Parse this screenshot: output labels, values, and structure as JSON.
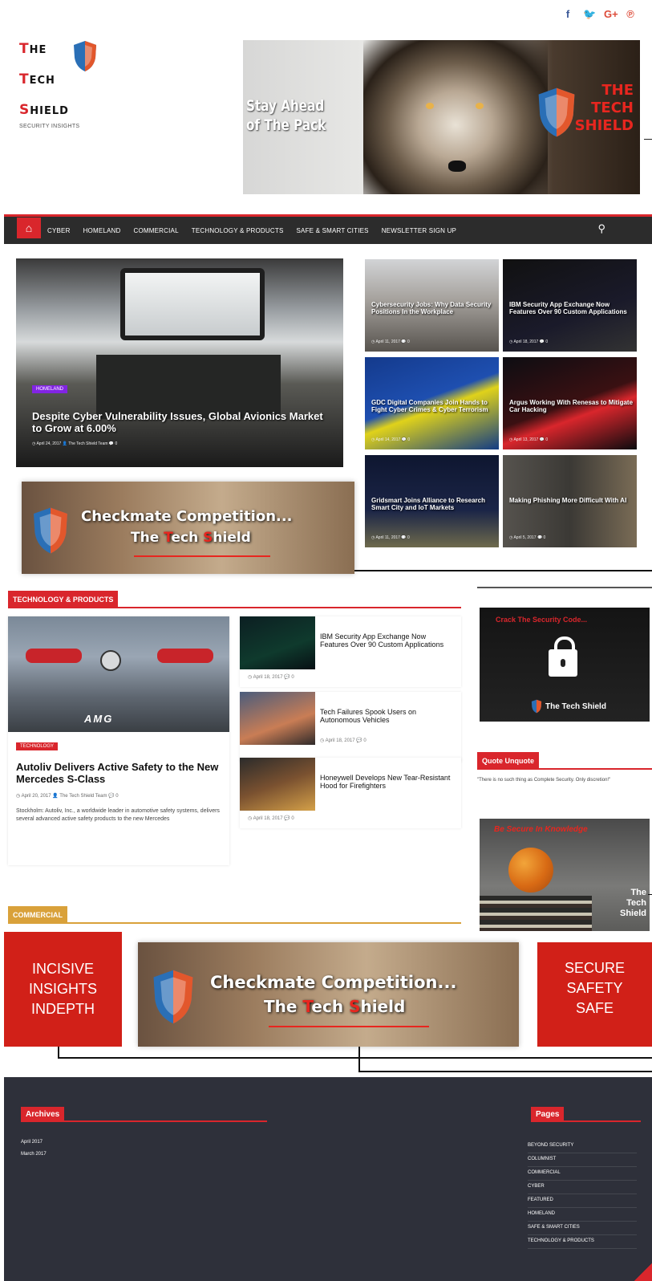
{
  "social": {
    "facebook": "f",
    "twitter": "🐦",
    "googleplus": "G+",
    "pinterest": "℗"
  },
  "logo": {
    "line1_cap": "T",
    "line1_rest": "HE",
    "line2_cap": "T",
    "line2_rest": "ECH",
    "line3_cap": "S",
    "line3_rest": "HIELD",
    "tagline": "SECURITY INSIGHTS",
    "icon": "shield-icon"
  },
  "hero": {
    "slogan_line1": "Stay Ahead",
    "slogan_line2": "of The Pack",
    "brand_line1": "THE",
    "brand_line2": "TECH",
    "brand_line3": "SHIELD"
  },
  "nav": {
    "home_icon": "⌂",
    "items": [
      "CYBER",
      "HOMELAND",
      "COMMERCIAL",
      "TECHNOLOGY & PRODUCTS",
      "SAFE & SMART CITIES",
      "NEWSLETTER SIGN UP"
    ],
    "search_icon": "⚲"
  },
  "featured": {
    "main": {
      "tag": "HOMELAND",
      "title": "Despite Cyber Vulnerability Issues, Global Avionics Market to Grow at 6.00%",
      "meta": "◷ April 24, 2017   👤 The Tech Shield Team   💬 0"
    },
    "tiles": [
      {
        "title": "Cybersecurity Jobs: Why Data Security Positions In the Workplace",
        "meta": "◷ April 11, 2017   💬 0"
      },
      {
        "title": "IBM Security App Exchange Now Features Over 90 Custom Applications",
        "meta": "◷ April 18, 2017   💬 0"
      },
      {
        "title": "GDC Digital Companies Join Hands to Fight Cyber Crimes & Cyber Terrorism",
        "meta": "◷ April 14, 2017   💬 0"
      },
      {
        "title": "Argus Working With Renesas to Mitigate Car Hacking",
        "meta": "◷ April 13, 2017   💬 0"
      },
      {
        "title": "Gridsmart Joins Alliance to Research Smart City and IoT Markets",
        "meta": "◷ April 11, 2017   💬 0"
      },
      {
        "title": "Making Phishing More Difficult With AI",
        "meta": "◷ April 5, 2017   💬 0"
      }
    ]
  },
  "checkmate": {
    "line1": "Checkmate Competition...",
    "line2_a": "The ",
    "line2_b": "T",
    "line2_c": "ech ",
    "line2_d": "S",
    "line2_e": "hield"
  },
  "sections": {
    "tech_products": "TECHNOLOGY & PRODUCTS",
    "commercial": "COMMERCIAL",
    "quote": "Quote Unquote"
  },
  "tech_big": {
    "image_text": "AMG",
    "tag": "TECHNOLOGY",
    "title": "Autoliv Delivers Active Safety to the New Mercedes S-Class",
    "meta": "◷ April 20, 2017   👤 The Tech Shield Team   💬 0",
    "excerpt": "Stockholm: Autoliv, Inc., a worldwide leader in automotive safety systems, delivers several advanced active safety products to the new Mercedes"
  },
  "tech_side": [
    {
      "title": "IBM Security App Exchange Now Features Over 90 Custom Applications",
      "meta": "◷ April 18, 2017   💬 0"
    },
    {
      "title": "Tech Failures Spook Users on Autonomous Vehicles",
      "meta": "◷ April 18, 2017   💬 0"
    },
    {
      "title": "Honeywell Develops New Tear-Resistant Hood for Firefighters",
      "meta": "◷ April 18, 2017   💬 0"
    }
  ],
  "widgets": {
    "code_title": "Crack The Security Code...",
    "code_brand": "The Tech Shield",
    "quote_text": "\"There is no such thing as Complete Security. Only discretion!\"",
    "know_title": "Be Secure In Knowledge",
    "know_brand_line1": "The",
    "know_brand_line2": "Tech",
    "know_brand_line3": "Shield"
  },
  "redboxes": {
    "left_line1": "INCISIVE",
    "left_line2": "INSIGHTS",
    "left_line3": "INDEPTH",
    "right_line1": "SECURE",
    "right_line2": "SAFETY",
    "right_line3": "SAFE"
  },
  "footer": {
    "archives_title": "Archives",
    "archives": [
      "April 2017",
      "March 2017"
    ],
    "pages_title": "Pages",
    "pages": [
      "BEYOND SECURITY",
      "COLUMNIST",
      "COMMERCIAL",
      "CYBER",
      "FEATURED",
      "HOMELAND",
      "SAFE & SMART CITIES",
      "TECHNOLOGY & PRODUCTS"
    ]
  },
  "colors": {
    "accent": "#d9262c",
    "nav_bg": "#2c2c2c",
    "footer_bg": "#2e303a",
    "commercial": "#d9a13a",
    "homeland_tag": "#8224e3"
  }
}
